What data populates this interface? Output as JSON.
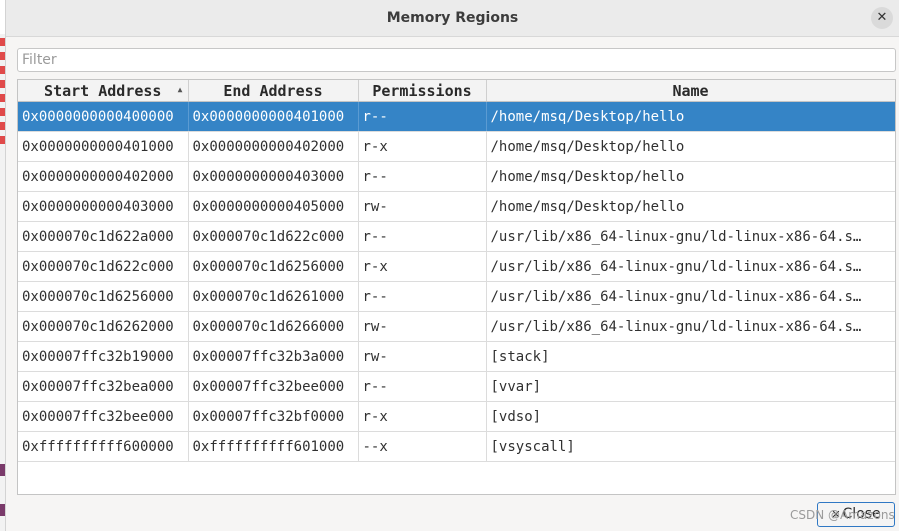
{
  "dialog": {
    "title": "Memory Regions",
    "close_glyph": "✕"
  },
  "filter": {
    "placeholder": "Filter",
    "value": ""
  },
  "table": {
    "columns": [
      "Start Address",
      "End Address",
      "Permissions",
      "Name"
    ],
    "sorted_column": "Start Address",
    "sort_glyph": "▲",
    "selected_row": 0,
    "rows": [
      {
        "start": "0x0000000000400000",
        "end": "0x0000000000401000",
        "perm": "r--",
        "name": "/home/msq/Desktop/hello"
      },
      {
        "start": "0x0000000000401000",
        "end": "0x0000000000402000",
        "perm": "r-x",
        "name": "/home/msq/Desktop/hello"
      },
      {
        "start": "0x0000000000402000",
        "end": "0x0000000000403000",
        "perm": "r--",
        "name": "/home/msq/Desktop/hello"
      },
      {
        "start": "0x0000000000403000",
        "end": "0x0000000000405000",
        "perm": "rw-",
        "name": "/home/msq/Desktop/hello"
      },
      {
        "start": "0x000070c1d622a000",
        "end": "0x000070c1d622c000",
        "perm": "r--",
        "name": "/usr/lib/x86_64-linux-gnu/ld-linux-x86-64.s…"
      },
      {
        "start": "0x000070c1d622c000",
        "end": "0x000070c1d6256000",
        "perm": "r-x",
        "name": "/usr/lib/x86_64-linux-gnu/ld-linux-x86-64.s…"
      },
      {
        "start": "0x000070c1d6256000",
        "end": "0x000070c1d6261000",
        "perm": "r--",
        "name": "/usr/lib/x86_64-linux-gnu/ld-linux-x86-64.s…"
      },
      {
        "start": "0x000070c1d6262000",
        "end": "0x000070c1d6266000",
        "perm": "rw-",
        "name": "/usr/lib/x86_64-linux-gnu/ld-linux-x86-64.s…"
      },
      {
        "start": "0x00007ffc32b19000",
        "end": "0x00007ffc32b3a000",
        "perm": "rw-",
        "name": "[stack]"
      },
      {
        "start": "0x00007ffc32bea000",
        "end": "0x00007ffc32bee000",
        "perm": "r--",
        "name": "[vvar]"
      },
      {
        "start": "0x00007ffc32bee000",
        "end": "0x00007ffc32bf0000",
        "perm": "r-x",
        "name": "[vdso]"
      },
      {
        "start": "0xffffffffff600000",
        "end": "0xffffffffff601000",
        "perm": "--x",
        "name": "[vsyscall]"
      }
    ]
  },
  "footer": {
    "close_label": "Close",
    "close_icon": "close-icon",
    "watermark": "CSDN @Amazons"
  },
  "colors": {
    "selection": "#3584c6",
    "focus_border": "#2f78c4"
  }
}
